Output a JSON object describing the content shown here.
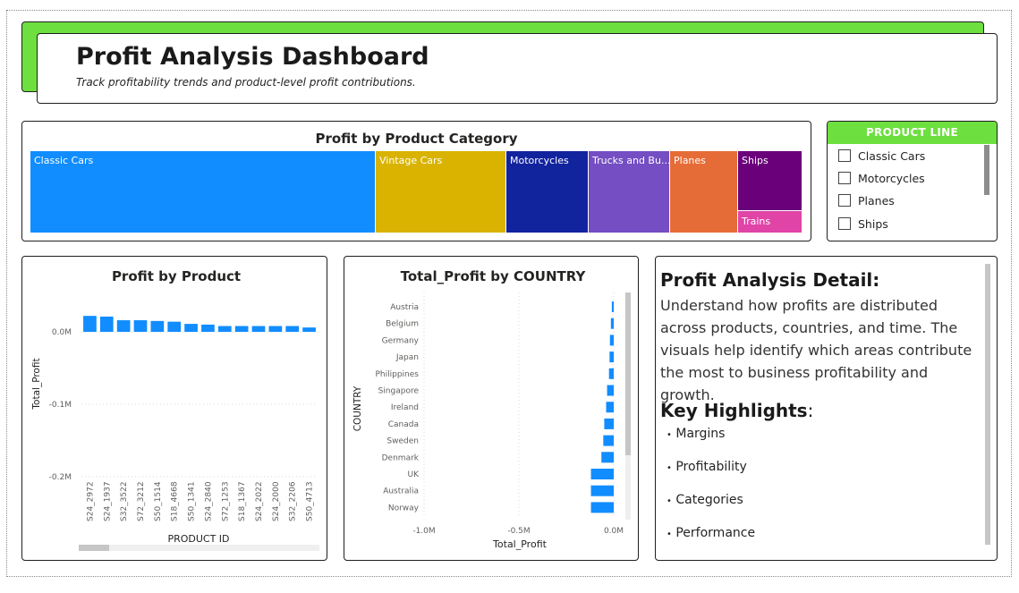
{
  "header": {
    "title": "Profit Analysis Dashboard",
    "subtitle": "Track profitability trends and product-level profit contributions."
  },
  "treemap": {
    "title": "Profit by Product Category",
    "cells": [
      {
        "label": "Classic Cars",
        "color": "#118dff"
      },
      {
        "label": "Vintage Cars",
        "color": "#d9b300"
      },
      {
        "label": "Motorcycles",
        "color": "#12239e"
      },
      {
        "label": "Trucks and Bu...",
        "color": "#744ec2"
      },
      {
        "label": "Planes",
        "color": "#e66c37"
      },
      {
        "label": "Ships",
        "color": "#6b007b"
      },
      {
        "label": "Trains",
        "color": "#e044a7"
      }
    ]
  },
  "slicer": {
    "header": "PRODUCT LINE",
    "items": [
      "Classic Cars",
      "Motorcycles",
      "Planes",
      "Ships"
    ]
  },
  "chart_data": [
    {
      "type": "bar",
      "title": "Profit by Product",
      "xlabel": "PRODUCT ID",
      "ylabel": "Total_Profit",
      "yticks": [
        "0.0M",
        "-0.1M",
        "-0.2M"
      ],
      "ylim": [
        -0.2,
        0.0
      ],
      "categories": [
        "S24_2972",
        "S24_1937",
        "S32_3522",
        "S72_3212",
        "S50_1514",
        "S18_4668",
        "S50_1341",
        "S24_2840",
        "S72_1253",
        "S18_1367",
        "S24_2022",
        "S24_2000",
        "S32_2206",
        "S50_4713"
      ],
      "values": [
        0.022,
        0.021,
        0.016,
        0.016,
        0.015,
        0.014,
        0.011,
        0.01,
        0.008,
        0.008,
        0.008,
        0.008,
        0.008,
        0.006
      ]
    },
    {
      "type": "bar",
      "title": "Total_Profit by COUNTRY",
      "xlabel": "Total_Profit",
      "ylabel": "COUNTRY",
      "xticks": [
        "-1.0M",
        "-0.5M",
        "0.0M"
      ],
      "xlim": [
        -1.0,
        0.0
      ],
      "categories": [
        "Austria",
        "Belgium",
        "Germany",
        "Japan",
        "Philippines",
        "Singapore",
        "Ireland",
        "Canada",
        "Sweden",
        "Denmark",
        "UK",
        "Australia",
        "Norway"
      ],
      "values": [
        -0.01,
        -0.015,
        -0.02,
        -0.022,
        -0.025,
        -0.035,
        -0.04,
        -0.05,
        -0.055,
        -0.065,
        -0.12,
        -0.12,
        -0.12
      ]
    }
  ],
  "detail": {
    "heading": "Profit Analysis Detail:",
    "paragraph": "Understand how profits are distributed across products, countries, and time. The visuals help identify which areas contribute the most to business profitability and growth.",
    "highlights_heading": "Key Highlights",
    "highlights_colon": ":",
    "highlights": [
      "Margins",
      "Profitability",
      "Categories",
      "Performance"
    ],
    "bullet": "•"
  }
}
